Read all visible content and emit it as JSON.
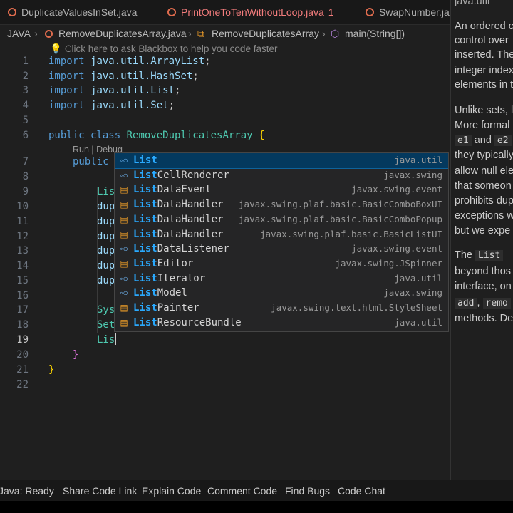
{
  "tabs": [
    {
      "label": "DuplicateValuesInSet.java",
      "active": false,
      "badge": ""
    },
    {
      "label": "PrintOneToTenWithoutLoop.java",
      "active": true,
      "badge": "1"
    },
    {
      "label": "SwapNumber.ja",
      "active": false,
      "badge": ""
    }
  ],
  "breadcrumb": {
    "root": "JAVA",
    "file": "RemoveDuplicatesArray.java",
    "class": "RemoveDuplicatesArray",
    "method": "main(String[])"
  },
  "hint": "Click here to ask Blackbox to help you code faster",
  "line_numbers": [
    "1",
    "2",
    "3",
    "4",
    "5",
    "6",
    "7",
    "8",
    "9",
    "10",
    "11",
    "12",
    "13",
    "14",
    "15",
    "16",
    "17",
    "18",
    "19",
    "20",
    "21",
    "22"
  ],
  "code": {
    "l1": {
      "kw": "import",
      "pkg": "java.util.ArrayList",
      "end": ";"
    },
    "l2": {
      "kw": "import",
      "pkg": "java.util.HashSet",
      "end": ";"
    },
    "l3": {
      "kw": "import",
      "pkg": "java.util.List",
      "end": ";"
    },
    "l4": {
      "kw": "import",
      "pkg": "java.util.Set",
      "end": ";"
    },
    "l6": {
      "kw": "public class",
      "cls": "RemoveDuplicatesArray",
      "brace": "{"
    },
    "lens": "Run | Debug",
    "l7": "public",
    "l9": "Lis",
    "l10": "dup",
    "l11": "dup",
    "l12": "dup",
    "l13": "dup",
    "l14": "dup",
    "l15": "dup",
    "l17": "Sys",
    "l18": "Set",
    "l19": "Lis",
    "l20": "}",
    "l21": "}"
  },
  "suggestions": [
    {
      "match": "List",
      "rest": "",
      "pkg": "java.util",
      "kind": "interface",
      "selected": true
    },
    {
      "match": "List",
      "rest": "CellRenderer",
      "pkg": "javax.swing",
      "kind": "interface",
      "selected": false
    },
    {
      "match": "List",
      "rest": "DataEvent",
      "pkg": "javax.swing.event",
      "kind": "class",
      "selected": false
    },
    {
      "match": "List",
      "rest": "DataHandler",
      "pkg": "javax.swing.plaf.basic.BasicComboBoxUI",
      "kind": "class",
      "selected": false
    },
    {
      "match": "List",
      "rest": "DataHandler",
      "pkg": "javax.swing.plaf.basic.BasicComboPopup",
      "kind": "class",
      "selected": false
    },
    {
      "match": "List",
      "rest": "DataHandler",
      "pkg": "javax.swing.plaf.basic.BasicListUI",
      "kind": "class",
      "selected": false
    },
    {
      "match": "List",
      "rest": "DataListener",
      "pkg": "javax.swing.event",
      "kind": "interface",
      "selected": false
    },
    {
      "match": "List",
      "rest": "Editor",
      "pkg": "javax.swing.JSpinner",
      "kind": "class",
      "selected": false
    },
    {
      "match": "List",
      "rest": "Iterator",
      "pkg": "java.util",
      "kind": "interface",
      "selected": false
    },
    {
      "match": "List",
      "rest": "Model",
      "pkg": "javax.swing",
      "kind": "interface",
      "selected": false
    },
    {
      "match": "List",
      "rest": "Painter",
      "pkg": "javax.swing.text.html.StyleSheet",
      "kind": "class",
      "selected": false
    },
    {
      "match": "List",
      "rest": "ResourceBundle",
      "pkg": "java.util",
      "kind": "class",
      "selected": false
    }
  ],
  "icons": {
    "interface": "◦○",
    "class": "▤"
  },
  "docs": {
    "header": "java.util",
    "lines": [
      "An ordered c",
      "control over",
      "inserted. The",
      "integer index",
      "elements in t",
      "Unlike sets, l",
      "More formal",
      "they typically",
      "allow null ele",
      "that someon",
      "prohibits dup",
      "exceptions w",
      "but we expe",
      "beyond thos",
      "interface, on",
      "methods. De"
    ],
    "code_e1": "e1",
    "code_and": "and",
    "code_e2": "e2",
    "the_word": "The",
    "code_list": "List",
    "code_add": "add",
    "code_remo": "remo"
  },
  "statusbar": {
    "java": "Java: Ready",
    "share": "Share Code Link",
    "explain": "Explain Code",
    "comment": "Comment Code",
    "bugs": "Find Bugs",
    "chat": "Code Chat"
  },
  "colors": {
    "accent": "#0e639c",
    "error_tab": "#f27c7c",
    "keyword": "#569cd6",
    "type": "#4ec9b0"
  }
}
